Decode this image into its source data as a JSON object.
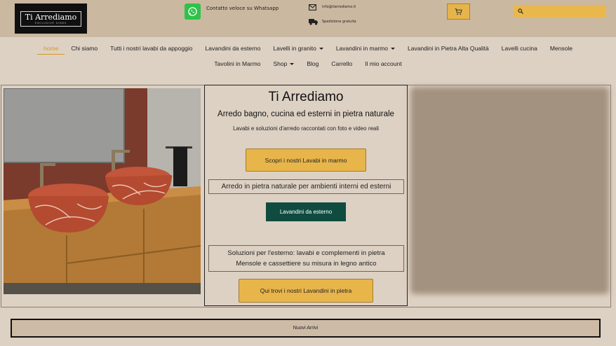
{
  "header": {
    "logo_title": "Ti Arrediamo",
    "logo_subtitle": "EXCLUSIVE SINKS",
    "whatsapp_text": "Contatto veloce su Whatsapp",
    "email_text": "info@tiarrediamo.it",
    "shipping_text": "Spedizione gratuita",
    "search_placeholder": ""
  },
  "nav": {
    "row1": [
      {
        "label": "home",
        "active": true
      },
      {
        "label": "Chi siamo"
      },
      {
        "label": "Tutti i nostri lavabi da appoggio"
      },
      {
        "label": "Lavandini da esterno"
      },
      {
        "label": "Lavelli in granito",
        "dropdown": true
      },
      {
        "label": "Lavandini in marmo",
        "dropdown": true
      },
      {
        "label": "Lavandini in Pietra Alta Qualità"
      },
      {
        "label": "Lavelli cucina"
      },
      {
        "label": "Mensole"
      }
    ],
    "row2": [
      {
        "label": "Tavolini in Marmo"
      },
      {
        "label": "Shop",
        "dropdown": true
      },
      {
        "label": "Blog"
      },
      {
        "label": "Carrello"
      },
      {
        "label": "Il mio account"
      }
    ]
  },
  "hero": {
    "title": "Ti Arrediamo",
    "subtitle": "Arredo bagno, cucina ed esterni in pietra naturale",
    "description": "Lavabi e soluzioni d'arredo raccontati con foto e video reali",
    "btn_lavabi": "Scopri i nostri Lavabi in marmo",
    "box_arredo": "Arredo in pietra naturale per ambienti interni ed esterni",
    "btn_esterno": "Lavandini da esterno",
    "box_soluzioni_line1": "Soluzioni per l'esterno: lavabi e complementi in pietra",
    "box_soluzioni_line2": "Mensole e cassettiere su misura in legno antico",
    "btn_qui": "Qui trovi i nostri Lavandini in pietra"
  },
  "bottom": {
    "label": "Nuovi Arrivi"
  },
  "colors": {
    "page_bg": "#ddd1c3",
    "header_bg": "#cbb8a0",
    "accent_gold": "#e8b54b",
    "nav_active": "#d39a27",
    "green_button": "#0f4c3f",
    "whatsapp_green": "#2ec24a"
  }
}
